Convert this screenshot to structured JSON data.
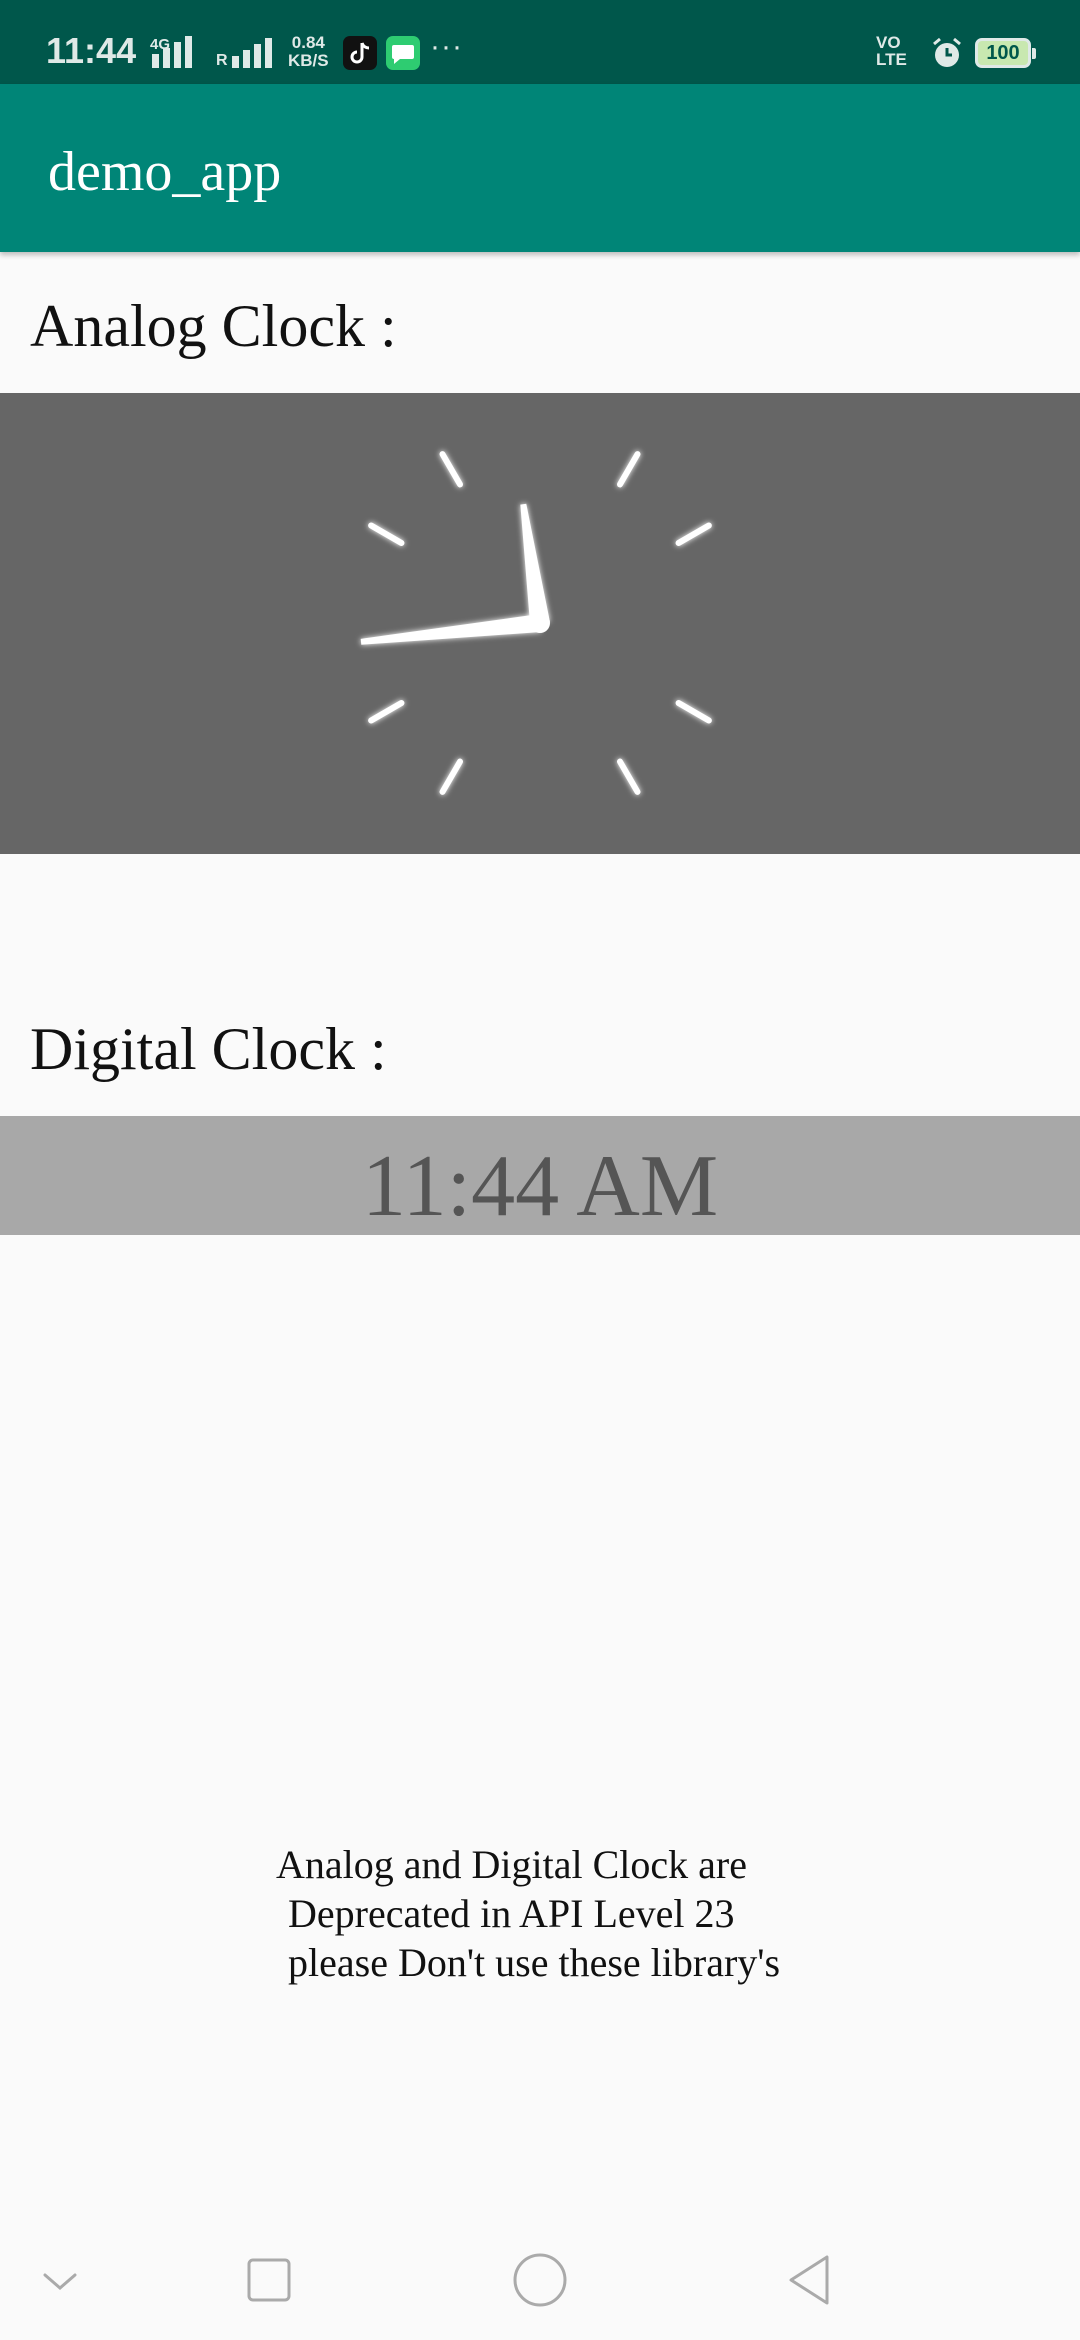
{
  "status_bar": {
    "time": "11:44",
    "network_type": "4G",
    "roaming": "R",
    "speed_value": "0.84",
    "speed_unit": "KB/S",
    "more": "···",
    "volte_top": "VO",
    "volte_bottom": "LTE",
    "battery": "100",
    "icons": [
      "tiktok-icon",
      "message-icon",
      "alarm-icon",
      "battery-icon"
    ]
  },
  "app_bar": {
    "title": "demo_app",
    "color": "#008577"
  },
  "analog": {
    "label": "Analog Clock :",
    "hour": 11,
    "minute": 44,
    "panel_color": "#666666"
  },
  "digital": {
    "label": "Digital Clock :",
    "time": "11:44 AM",
    "panel_color": "#a8a8a8"
  },
  "note": {
    "line1": "Analog and Digital Clock are",
    "line2": "Deprecated in API Level 23",
    "line3": "please Don't use these library's"
  },
  "nav": {
    "icons": [
      "chevron-down-icon",
      "recents-square-icon",
      "home-circle-icon",
      "back-triangle-icon"
    ]
  }
}
